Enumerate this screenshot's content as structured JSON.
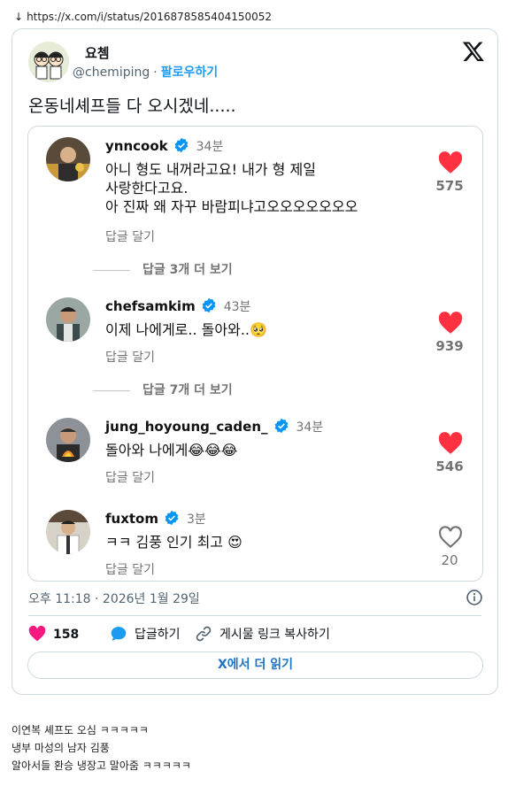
{
  "page": {
    "download_arrow": "↓",
    "url": "https://x.com/i/status/2016878585404150052"
  },
  "tweet": {
    "author_name": "요쳄",
    "author_handle": "@chemiping",
    "separator": "·",
    "follow_label": "팔로우하기",
    "text": "온동네셰프들 다 오시겠네.....",
    "timestamp": "오후 11:18 · 2026년 1월 29일",
    "likes": "158",
    "reply_label": "답글하기",
    "copy_link_label": "게시물 링크 복사하기",
    "read_more_label": "X에서 더 읽기",
    "colors": {
      "accent": "#1d9bf0",
      "like_pink": "#f91880",
      "border": "#cfd9de"
    }
  },
  "embed": {
    "comments": [
      {
        "user": "ynncook",
        "time": "34분",
        "lines": [
          "아니 형도 내꺼라고요! 내가 형 제일",
          "사랑한다고요.",
          "아 진짜 왜 자꾸 바람피냐고오오오오오오오"
        ],
        "reply": "답글 달기",
        "likes": "575",
        "liked": true
      },
      {
        "user": "chefsamkim",
        "time": "43분",
        "lines": [
          "이제 나에게로.. 돌아와..🥺"
        ],
        "reply": "답글 달기",
        "likes": "939",
        "liked": true
      },
      {
        "user": "jung_hoyoung_caden_",
        "time": "34분",
        "lines": [
          "돌아와 나에게😂😂😂"
        ],
        "reply": "답글 달기",
        "likes": "546",
        "liked": true
      },
      {
        "user": "fuxtom",
        "time": "3분",
        "lines": [
          "ㅋㅋ 김풍 인기 최고 😍"
        ],
        "reply": "답글 달기",
        "likes": "20",
        "liked": false
      }
    ],
    "more_replies": [
      "답글 3개 더 보기",
      "답글 7개 더 보기"
    ]
  },
  "footer": {
    "lines": [
      "이연복 셰프도 오심 ㅋㅋㅋㅋㅋ",
      "냉부 마성의 남자 김풍",
      "알아서들 환승 냉장고 말아줌 ㅋㅋㅋㅋㅋ"
    ]
  }
}
